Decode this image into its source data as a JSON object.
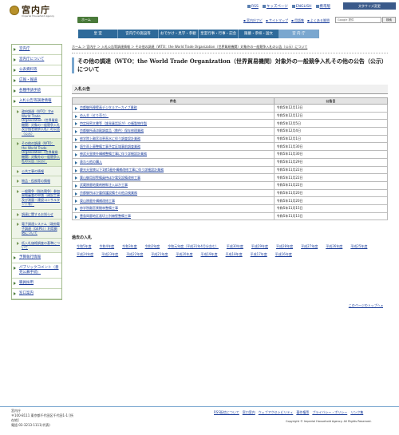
{
  "header": {
    "logo_title": "宮内庁",
    "logo_sub": "Imperial Household Agency",
    "home_label": "ホーム",
    "util_links": [
      "RSS",
      "キッズページ",
      "ENGLISH",
      "携帯版"
    ],
    "lang_button": "文字サイズ変更",
    "sub_links": [
      "▪ 宮内庁ナビ",
      "▪ サイトマップ",
      "▪ 用語集",
      "▪ よくある質問"
    ],
    "search_placeholder": "Google 提供",
    "search_button": "検索"
  },
  "gnav": [
    "皇 室",
    "宮内庁の施設等",
    "おでかけ・見学・参観",
    "皇室行事・行事・記念日",
    "陵墓・参拝・国文",
    "宮 内 庁"
  ],
  "sidebar": {
    "items": [
      {
        "label": "宮内庁",
        "sub": false
      },
      {
        "label": "宮内庁について",
        "sub": false
      },
      {
        "label": "公表資料等",
        "sub": false
      },
      {
        "label": "広報・報道",
        "sub": false
      },
      {
        "label": "各種申請手続",
        "sub": false
      },
      {
        "label": "入札公告等調達情報",
        "sub": false
      },
      {
        "label": "政府調達（WTO：the World Trade Organization（世界貿易機関）対象の一般競争入札及び指名競争入札）の公告（公示）",
        "sub": true
      },
      {
        "label": "その他の調達（WTO：the World Trade Organization（世界貿易機関）対象外の一般競争入札の公告（公示）",
        "sub": true,
        "active": true
      },
      {
        "label": "公共工事の情報",
        "sub": true
      },
      {
        "label": "物品・役務等の情報",
        "sub": true
      },
      {
        "label": "一般競争（指名競争）参加資格審査の申請（建設工事及び測量・建設コンサルタント等）",
        "sub": true
      },
      {
        "label": "調達に関するお知らせ",
        "sub": true
      },
      {
        "label": "電子調達システム（政府電子調達（GEPS））利用開始について",
        "sub": true
      },
      {
        "label": "低入札価格調査の基準について",
        "sub": true
      },
      {
        "label": "予算執行情報",
        "sub": false
      },
      {
        "label": "パブリックコメント（意見公募手続）",
        "sub": false
      },
      {
        "label": "職員採用",
        "sub": false
      },
      {
        "label": "窓口案内",
        "sub": false
      }
    ],
    "footer": [
      "宮内庁",
      "〒100-8111 東京都千代田区千代田1-1 [所在地]",
      "電話:03-3213-1111(代表)"
    ]
  },
  "main": {
    "breadcrumb": "ホーム ＞ 宮内庁 ＞ 入札公告等調達情報 ＞ その他の調達（WTO：the World Trade Organization（世界貿易機関）対象外の一般競争入札の公告（公示）について",
    "title": "その他の調達（WTO：the World Trade Organization（世界貿易機関）対象外の一般競争入札その他の公告（公示）について",
    "section": "入札公告",
    "table": {
      "headers": [
        "件名",
        "公告日"
      ],
      "rows": [
        [
          "京都御所障壁画デジタルアーカイブ業務",
          "令和5年12月13日"
        ],
        [
          "めん羊（せり売り）",
          "令和5年12月12日"
        ],
        [
          "特定秘密文書等（誰発乗話証が）の複製物作製",
          "令和5年12月5日"
        ],
        [
          "京都御所清涼殿調度品（数件）保存修理業務",
          "令和5年12月4日"
        ],
        [
          "修学院上離宮浴恵直水に伴う調査設計業務",
          "令和5年12月1日"
        ],
        [
          "埴生雨上墓整備工事予定区域事前調査業務",
          "令和5年11月30日"
        ],
        [
          "神武天皇陵外構補整備工事に伴う詳細設計業務",
          "令和5年11月30日"
        ],
        [
          "表わら他の購入",
          "令和5年11月29日"
        ],
        [
          "慶光天皇陵以下1陵5墓外構補改修工事に伴う詳細設計業務",
          "令和5年11月22日"
        ],
        [
          "葉山御用邸警備員待ほか電気設備改修工事",
          "令和5年11月22日"
        ],
        [
          "武蔵陵墓地薬剤樹幹注入ほか工事",
          "令和5年11月22日"
        ],
        [
          "京都御所ほか震保護設備その他点検業務",
          "令和5年11月20日"
        ],
        [
          "東山陵墓外構補改修工事",
          "令和5年11月20日"
        ],
        [
          "修学院離宮景観林整備工事",
          "令和5年11月15日"
        ],
        [
          "豊島岡墓地区画切土別擁壁整備工事",
          "令和5年11月13日"
        ]
      ]
    },
    "past_head": "過去の入札",
    "past_years": [
      "令和5年度",
      "令和4年度",
      "令和3年度",
      "令和2年度",
      "令和元年度（平成31年4月分含む）",
      "平成30年度",
      "平成29年度",
      "平成28年度",
      "平成27年度",
      "平成26年度",
      "平成25年度",
      "平成24年度",
      "平成23年度",
      "平成22年度",
      "平成21年度",
      "平成20年度",
      "平成19年度",
      "平成18年度",
      "平成17年度",
      "平成16年度"
    ],
    "top_link": "このページのトップへ ▸"
  },
  "footer": {
    "links": [
      "RSS配信について",
      "窓口案内",
      "ウェブアクセシビリティ",
      "著作権等",
      "プライバシー・ポリシー",
      "リンク集"
    ],
    "copyright": "Copyright © Imperial Household Agency. All Rights Reserved."
  }
}
